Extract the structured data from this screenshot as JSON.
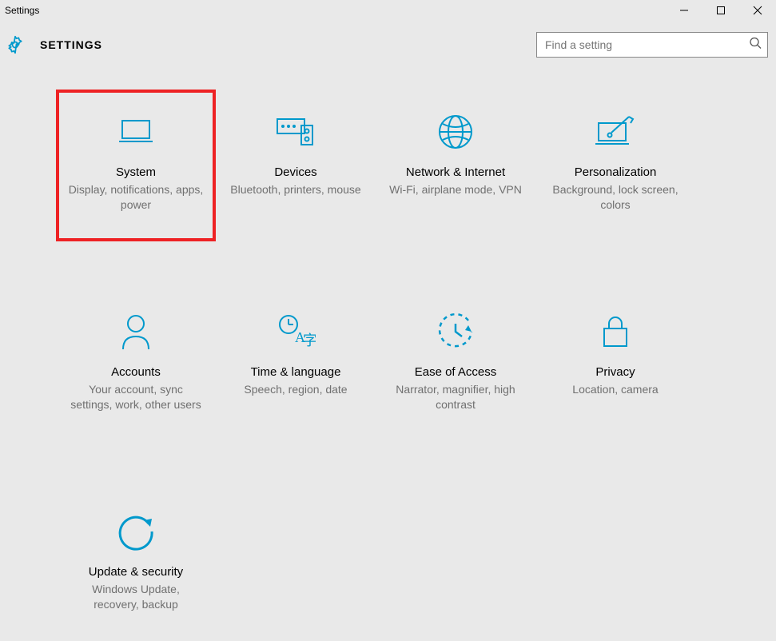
{
  "window": {
    "title": "Settings"
  },
  "header": {
    "title": "SETTINGS"
  },
  "search": {
    "placeholder": "Find a setting"
  },
  "tiles": [
    {
      "title": "System",
      "desc": "Display, notifications, apps, power"
    },
    {
      "title": "Devices",
      "desc": "Bluetooth, printers, mouse"
    },
    {
      "title": "Network & Internet",
      "desc": "Wi-Fi, airplane mode, VPN"
    },
    {
      "title": "Personalization",
      "desc": "Background, lock screen, colors"
    },
    {
      "title": "Accounts",
      "desc": "Your account, sync settings, work, other users"
    },
    {
      "title": "Time & language",
      "desc": "Speech, region, date"
    },
    {
      "title": "Ease of Access",
      "desc": "Narrator, magnifier, high contrast"
    },
    {
      "title": "Privacy",
      "desc": "Location, camera"
    },
    {
      "title": "Update & security",
      "desc": "Windows Update, recovery, backup"
    }
  ]
}
